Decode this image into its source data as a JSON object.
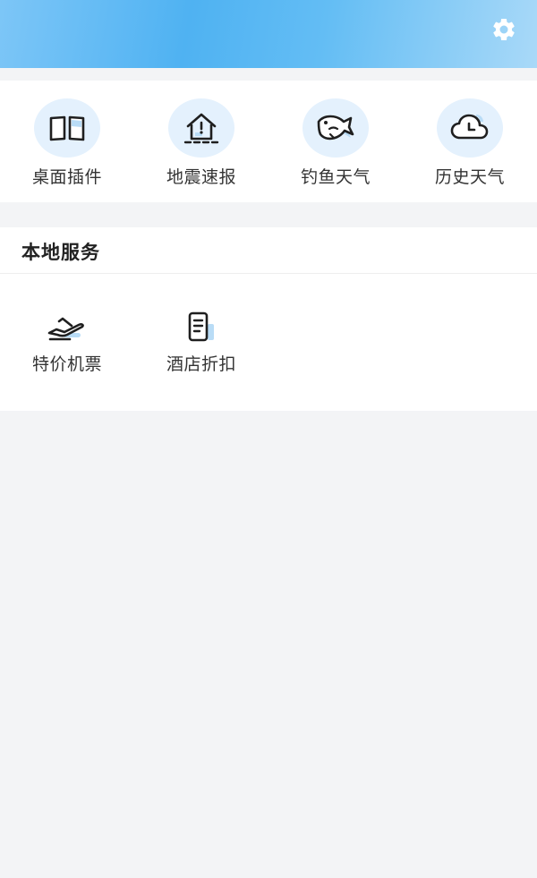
{
  "header": {
    "settings_icon": "gear-icon"
  },
  "tools": [
    {
      "label": "桌面插件",
      "icon": "book-icon"
    },
    {
      "label": "地震速报",
      "icon": "house-alert-icon"
    },
    {
      "label": "钓鱼天气",
      "icon": "fish-icon"
    },
    {
      "label": "历史天气",
      "icon": "cloud-clock-icon"
    }
  ],
  "local_services": {
    "title": "本地服务",
    "items": [
      {
        "label": "特价机票",
        "icon": "airplane-icon"
      },
      {
        "label": "酒店折扣",
        "icon": "document-icon"
      }
    ]
  },
  "colors": {
    "header_start": "#7dc6f7",
    "header_end": "#a9d9f8",
    "icon_bg": "#e4f1fd",
    "accent_light": "#b9dcf6",
    "background": "#f3f4f6"
  }
}
